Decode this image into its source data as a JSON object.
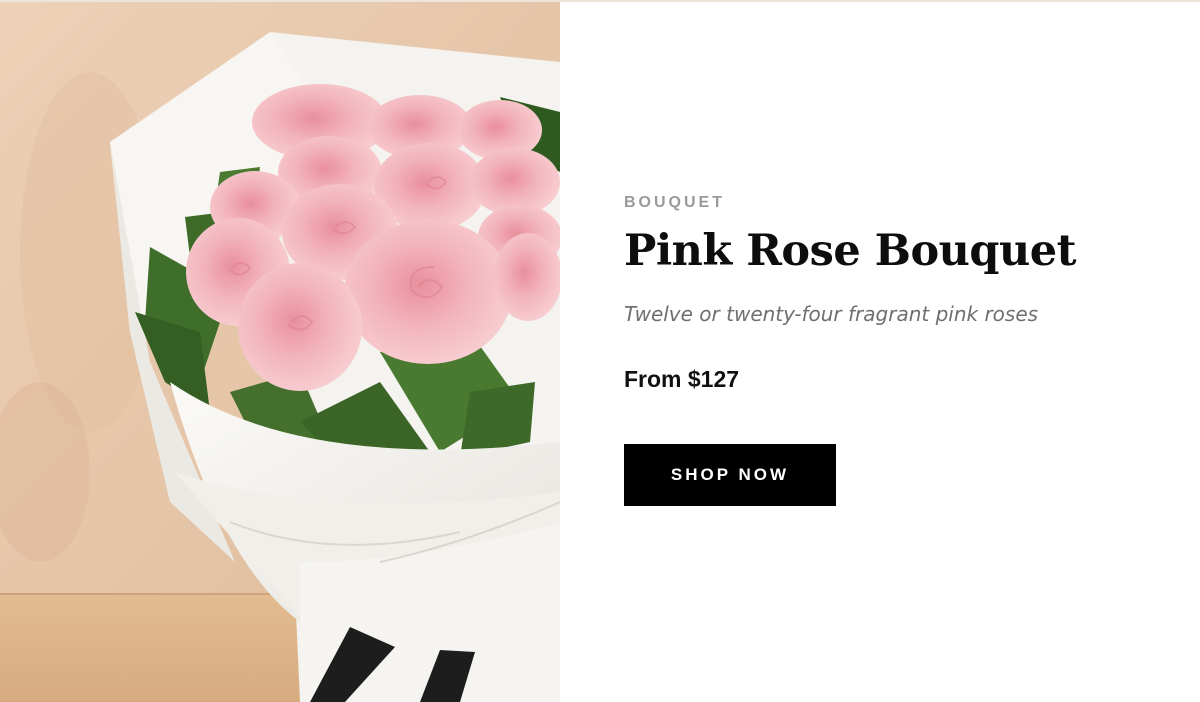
{
  "product": {
    "category": "BOUQUET",
    "name": "Pink Rose Bouquet",
    "description": "Twelve or twenty-four fragrant pink roses",
    "price": "From $127"
  },
  "cta": {
    "label": "SHOP NOW"
  },
  "photo": {
    "subject": "pink-rose-bouquet-photo"
  },
  "colors": {
    "button_bg": "#000000",
    "button_text": "#ffffff",
    "eyebrow": "#9a9a9a",
    "title": "#0d0d0d",
    "subtitle": "#6f6f6f",
    "rose_pink": "#f2b4bd",
    "wrap_white": "#f1f0ec",
    "backdrop": "#e8c9ad"
  }
}
